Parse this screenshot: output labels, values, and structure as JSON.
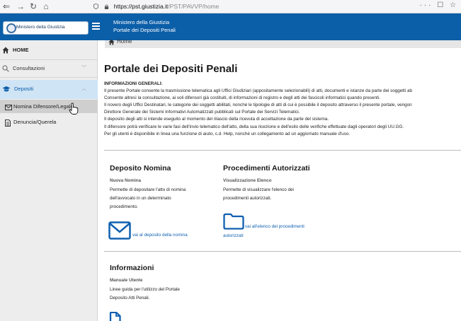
{
  "browser": {
    "url_host": "https://pst.giustizia.it",
    "url_path": "/PST/PAVVP/home",
    "menu_glyphs": "··· ☐ ☆"
  },
  "topbar": {
    "logo_text": "Ministero della Giustizia",
    "title_line1": "Ministero della Giustizia",
    "title_line2": "Portale dei Depositi Penali",
    "bg_color": "#0b5ea8"
  },
  "sidebar": {
    "home": "HOME",
    "consultazioni": "Consultazioni",
    "depositi": "Depositi",
    "nomina": "Nomina Difensore/Legale",
    "denuncia": "Denuncia/Querela"
  },
  "breadcrumb": {
    "label": "Home"
  },
  "main": {
    "title": "Portale dei Depositi Penali",
    "info_heading": "INFORMAZIONI GENERALI:",
    "info_lines": [
      "Il presente Portale consente la trasmissione telematica agli Uffici Giudiziari (appositamente selezionabili) di atti, documenti e istanze da parte dei soggetti ab",
      "Consente altresì la consultazione, ai soli difensori già costituiti, di informazioni di registro e degli atti dei fascicoli informatici quando presenti.",
      "Il novero degli Uffici Destinatari, le categorie dei soggetti abilitati, nonché le tipologie di atti di cui è possibile il deposito attraverso il presente portale, vengon",
      "Direttore Generale dei Sistemi Informativi Automatizzati pubblicati sul Portale dei Servizi Telematici.",
      "Il deposito degli atti si intende eseguito al momento del rilascio della ricevuta di accettazione da parte del sistema.",
      "Il difensore potrà verificare le varie fasi dell'invio telematico dell'atto, della sua ricezione e dell'esito delle verifiche effettuate dagli operatori degli UU.GG.",
      "Per gli utenti è disponibile in linea una funzione di aiuto, c.d. Help, nonché un collegamento ad un aggiornato manuale d'uso."
    ]
  },
  "cards": {
    "deposito": {
      "title": "Deposito Nomina",
      "subtitle": "Nuova Nomina",
      "desc": [
        "Permette di depositare l'atto di nomina",
        "dell'avvocato in un determinato",
        "procedimento."
      ],
      "link": "vai al deposito della nomina"
    },
    "procedimenti": {
      "title": "Procedimenti Autorizzati",
      "subtitle": "Visualizzazione Elenco",
      "desc": [
        "Permette di visualizzare l'elenco dei",
        "procedimenti autorizzati."
      ],
      "link1": "vai all'elenco dei procedimenti",
      "link2": "autorizzati"
    },
    "informazioni": {
      "title": "Informazioni",
      "subtitle": "Manuale Utente",
      "desc": [
        "Linee guida per l'utilizzo del Portale",
        "Deposito Atti Penali."
      ]
    }
  },
  "colors": {
    "accent": "#0b5ea8",
    "link": "#1060b0",
    "selected": "#cfe4f5"
  }
}
